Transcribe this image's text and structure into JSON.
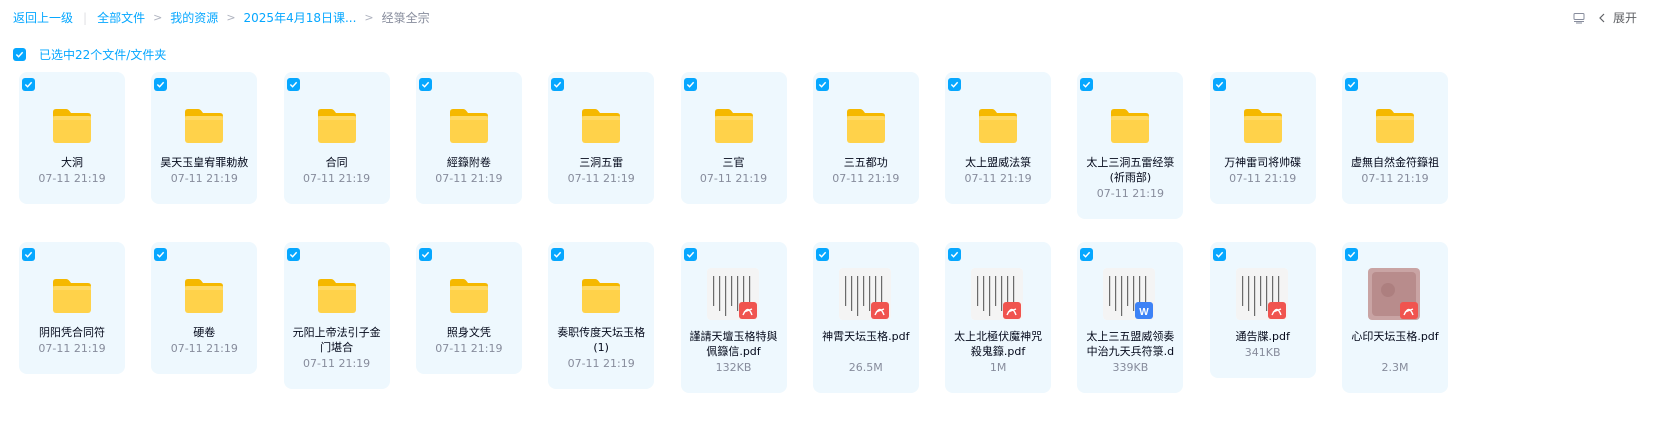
{
  "breadcrumb": {
    "back": "返回上一级",
    "items": [
      "全部文件",
      "我的资源",
      "2025年4月18日课...",
      "经箓全宗"
    ]
  },
  "toolbar": {
    "expand_label": "展开"
  },
  "selection": {
    "label": "已选中22个文件/文件夹"
  },
  "colors": {
    "accent": "#06a7ff",
    "card_bg": "#eef8fe",
    "folder": "#ffd24a",
    "pdf": "#f0544f",
    "doc": "#3d82f6"
  },
  "files_row1": [
    {
      "name": "大洞",
      "meta": "07-11 21:19",
      "type": "folder-icon"
    },
    {
      "name": "昊天玉皇宥罪勅赦",
      "meta": "07-11 21:19",
      "type": "folder-icon"
    },
    {
      "name": "合同",
      "meta": "07-11 21:19",
      "type": "folder-icon"
    },
    {
      "name": "經籙附卷",
      "meta": "07-11 21:19",
      "type": "folder-icon"
    },
    {
      "name": "三洞五雷",
      "meta": "07-11 21:19",
      "type": "folder-icon"
    },
    {
      "name": "三官",
      "meta": "07-11 21:19",
      "type": "folder-icon"
    },
    {
      "name": "三五都功",
      "meta": "07-11 21:19",
      "type": "folder-icon"
    },
    {
      "name": "太上盟威法箓",
      "meta": "07-11 21:19",
      "type": "folder-icon"
    },
    {
      "name": "太上三洞五雷经箓(祈雨部)",
      "meta": "07-11 21:19",
      "type": "folder-icon"
    },
    {
      "name": "万神雷司将帅碟",
      "meta": "07-11 21:19",
      "type": "folder-icon"
    },
    {
      "name": "虚無自然金符籙祖",
      "meta": "07-11 21:19",
      "type": "folder-icon"
    }
  ],
  "files_row2": [
    {
      "name": "阴阳凭合同符",
      "meta": "07-11 21:19",
      "type": "folder-icon"
    },
    {
      "name": "硬卷",
      "meta": "07-11 21:19",
      "type": "folder-icon"
    },
    {
      "name": "元阳上帝法引子金门堪合",
      "meta": "07-11 21:19",
      "type": "folder-icon"
    },
    {
      "name": "照身文凭",
      "meta": "07-11 21:19",
      "type": "folder-icon"
    },
    {
      "name": "奏职传度天坛玉格(1)",
      "meta": "07-11 21:19",
      "type": "folder-icon"
    },
    {
      "name": "謹請天壇玉格特與佩籙信.pdf",
      "meta": "132KB",
      "type": "pdf-icon"
    },
    {
      "name": "神霄天坛玉格.pdf",
      "meta": "26.5M",
      "type": "pdf-icon"
    },
    {
      "name": "太上北極伏魔神咒殺鬼籙.pdf",
      "meta": "1M",
      "type": "pdf-icon"
    },
    {
      "name": "太上三五盟威领奏中治九天兵符箓.d",
      "meta": "339KB",
      "type": "doc-icon"
    },
    {
      "name": "通告牒.pdf",
      "meta": "341KB",
      "type": "pdf-icon"
    },
    {
      "name": "心印天坛玉格.pdf",
      "meta": "2.3M",
      "type": "pdf-icon"
    }
  ]
}
